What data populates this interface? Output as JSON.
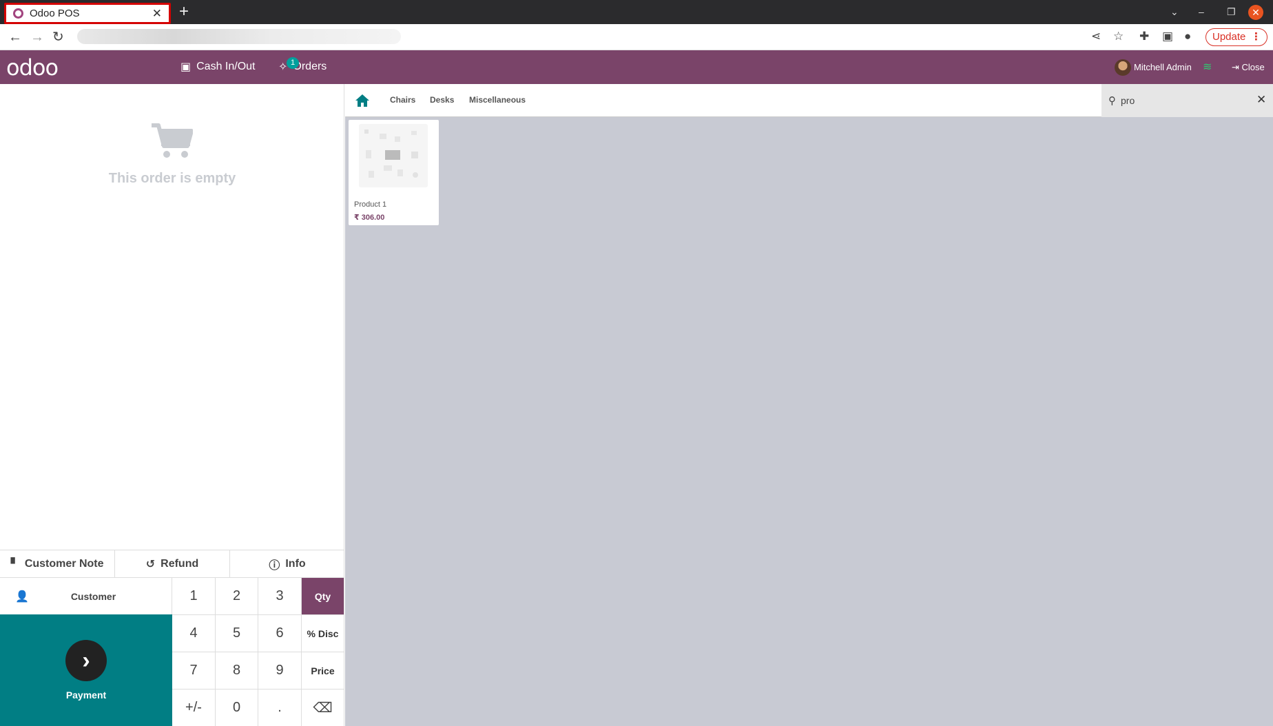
{
  "browser": {
    "tab_title": "Odoo POS",
    "update_label": "Update"
  },
  "header": {
    "logo": "odoo",
    "cash_label": "Cash In/Out",
    "orders_label": "Orders",
    "orders_badge": "1",
    "user_name": "Mitchell Admin",
    "close_label": "Close"
  },
  "order": {
    "empty_text": "This order is empty"
  },
  "controls": {
    "customer_note": "Customer Note",
    "refund": "Refund",
    "info": "Info"
  },
  "customer_label": "Customer",
  "payment_label": "Payment",
  "numpad": {
    "k1": "1",
    "k2": "2",
    "k3": "3",
    "qty": "Qty",
    "k4": "4",
    "k5": "5",
    "k6": "6",
    "disc": "% Disc",
    "k7": "7",
    "k8": "8",
    "k9": "9",
    "price": "Price",
    "sign": "+/-",
    "k0": "0",
    "dot": ".",
    "backspace": "⌫"
  },
  "categories": [
    "Chairs",
    "Desks",
    "Miscellaneous"
  ],
  "search": {
    "value": "pro"
  },
  "products": [
    {
      "name": "Product 1",
      "price": "₹ 306.00"
    }
  ],
  "colors": {
    "brand": "#7a4469",
    "payment": "#017e84",
    "badge": "#00a09d",
    "tab_highlight": "#d40000"
  }
}
